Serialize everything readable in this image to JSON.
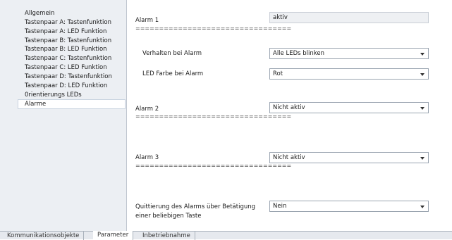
{
  "sidebar": {
    "items": [
      {
        "label": "Allgemein"
      },
      {
        "label": "Tastenpaar A: Tastenfunktion"
      },
      {
        "label": "Tastenpaar A: LED Funktion"
      },
      {
        "label": "Tastenpaar B: Tastenfunktion"
      },
      {
        "label": "Tastenpaar B: LED Funktion"
      },
      {
        "label": "Tastenpaar C: Tastenfunktion"
      },
      {
        "label": "Tastenpaar C: LED Funktion"
      },
      {
        "label": "Tastenpaar D: Tastenfunktion"
      },
      {
        "label": "Tastenpaar D: LED Funktion"
      },
      {
        "label": "0rientierungs LEDs"
      },
      {
        "label": "Alarme"
      }
    ],
    "selected": "Alarme"
  },
  "main": {
    "separator": "=================================",
    "alarm1": {
      "label": "Alarm 1",
      "value": "aktiv"
    },
    "verhalten": {
      "label": "Verhalten bei Alarm",
      "value": "Alle LEDs blinken"
    },
    "ledfarbe": {
      "label": "LED Farbe bei Alarm",
      "value": "Rot"
    },
    "alarm2": {
      "label": "Alarm 2",
      "value": "Nicht aktiv"
    },
    "alarm3": {
      "label": "Alarm 3",
      "value": "Nicht aktiv"
    },
    "quittierung": {
      "label_line1": "Quittierung des Alarms über Betätigung",
      "label_line2": "einer beliebigen Taste",
      "value": "Nein"
    }
  },
  "tabs": [
    {
      "label": "Kommunikationsobjekte"
    },
    {
      "label": "Parameter"
    },
    {
      "label": "Inbetriebnahme"
    }
  ]
}
